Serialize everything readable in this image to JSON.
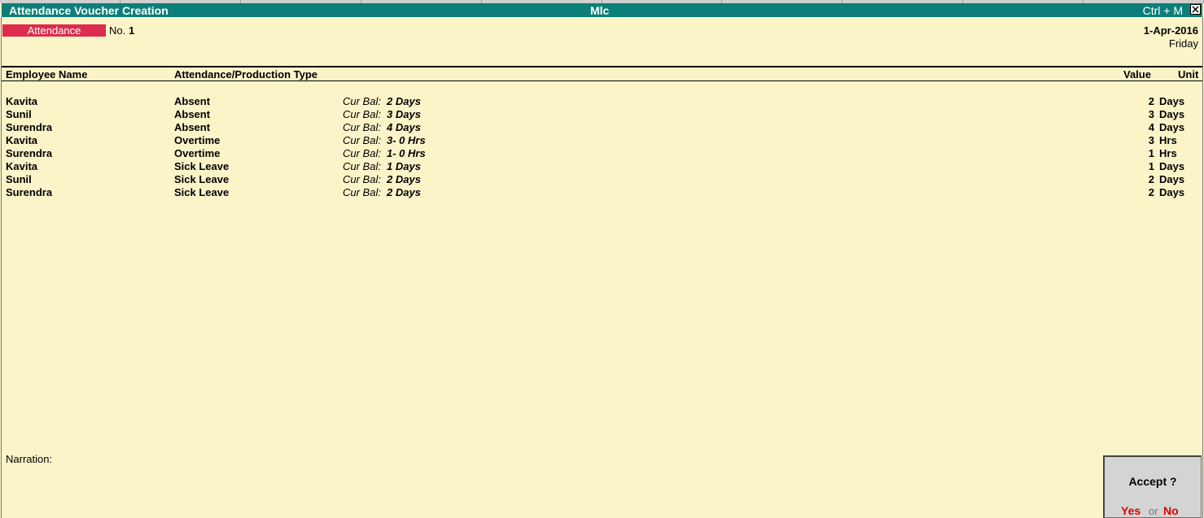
{
  "window": {
    "title": "Attendance Voucher  Creation",
    "company": "Mlc",
    "shortcut": "Ctrl + M"
  },
  "voucher": {
    "type": "Attendance",
    "no_label": "No.",
    "no": "1",
    "date": "1-Apr-2016",
    "day": "Friday"
  },
  "columns": {
    "employee": "Employee Name",
    "type": "Attendance/Production Type",
    "value": "Value",
    "unit": "Unit"
  },
  "cur_bal_label": "Cur Bal:",
  "rows": [
    {
      "employee": "Kavita",
      "type": "Absent",
      "cur_bal": "2 Days",
      "value": "2",
      "unit": "Days"
    },
    {
      "employee": "Sunil",
      "type": "Absent",
      "cur_bal": "3 Days",
      "value": "3",
      "unit": "Days"
    },
    {
      "employee": "Surendra",
      "type": "Absent",
      "cur_bal": "4 Days",
      "value": "4",
      "unit": "Days"
    },
    {
      "employee": "Kavita",
      "type": "Overtime",
      "cur_bal": "3- 0 Hrs",
      "value": "3",
      "unit": "Hrs"
    },
    {
      "employee": "Surendra",
      "type": "Overtime",
      "cur_bal": "1- 0 Hrs",
      "value": "1",
      "unit": "Hrs"
    },
    {
      "employee": "Kavita",
      "type": "Sick Leave",
      "cur_bal": "1 Days",
      "value": "1",
      "unit": "Days"
    },
    {
      "employee": "Sunil",
      "type": "Sick Leave",
      "cur_bal": "2 Days",
      "value": "2",
      "unit": "Days"
    },
    {
      "employee": "Surendra",
      "type": "Sick Leave",
      "cur_bal": "2 Days",
      "value": "2",
      "unit": "Days"
    }
  ],
  "narration_label": "Narration:",
  "accept": {
    "question": "Accept ?",
    "yes": "Yes",
    "or": "or",
    "no": "No"
  },
  "colors": {
    "titlebar": "#0d7f7a",
    "voucher_type": "#dc2b4e",
    "background": "#fbf4c9",
    "accept_choice": "#e00000"
  },
  "icons": {
    "close": "close-icon"
  }
}
